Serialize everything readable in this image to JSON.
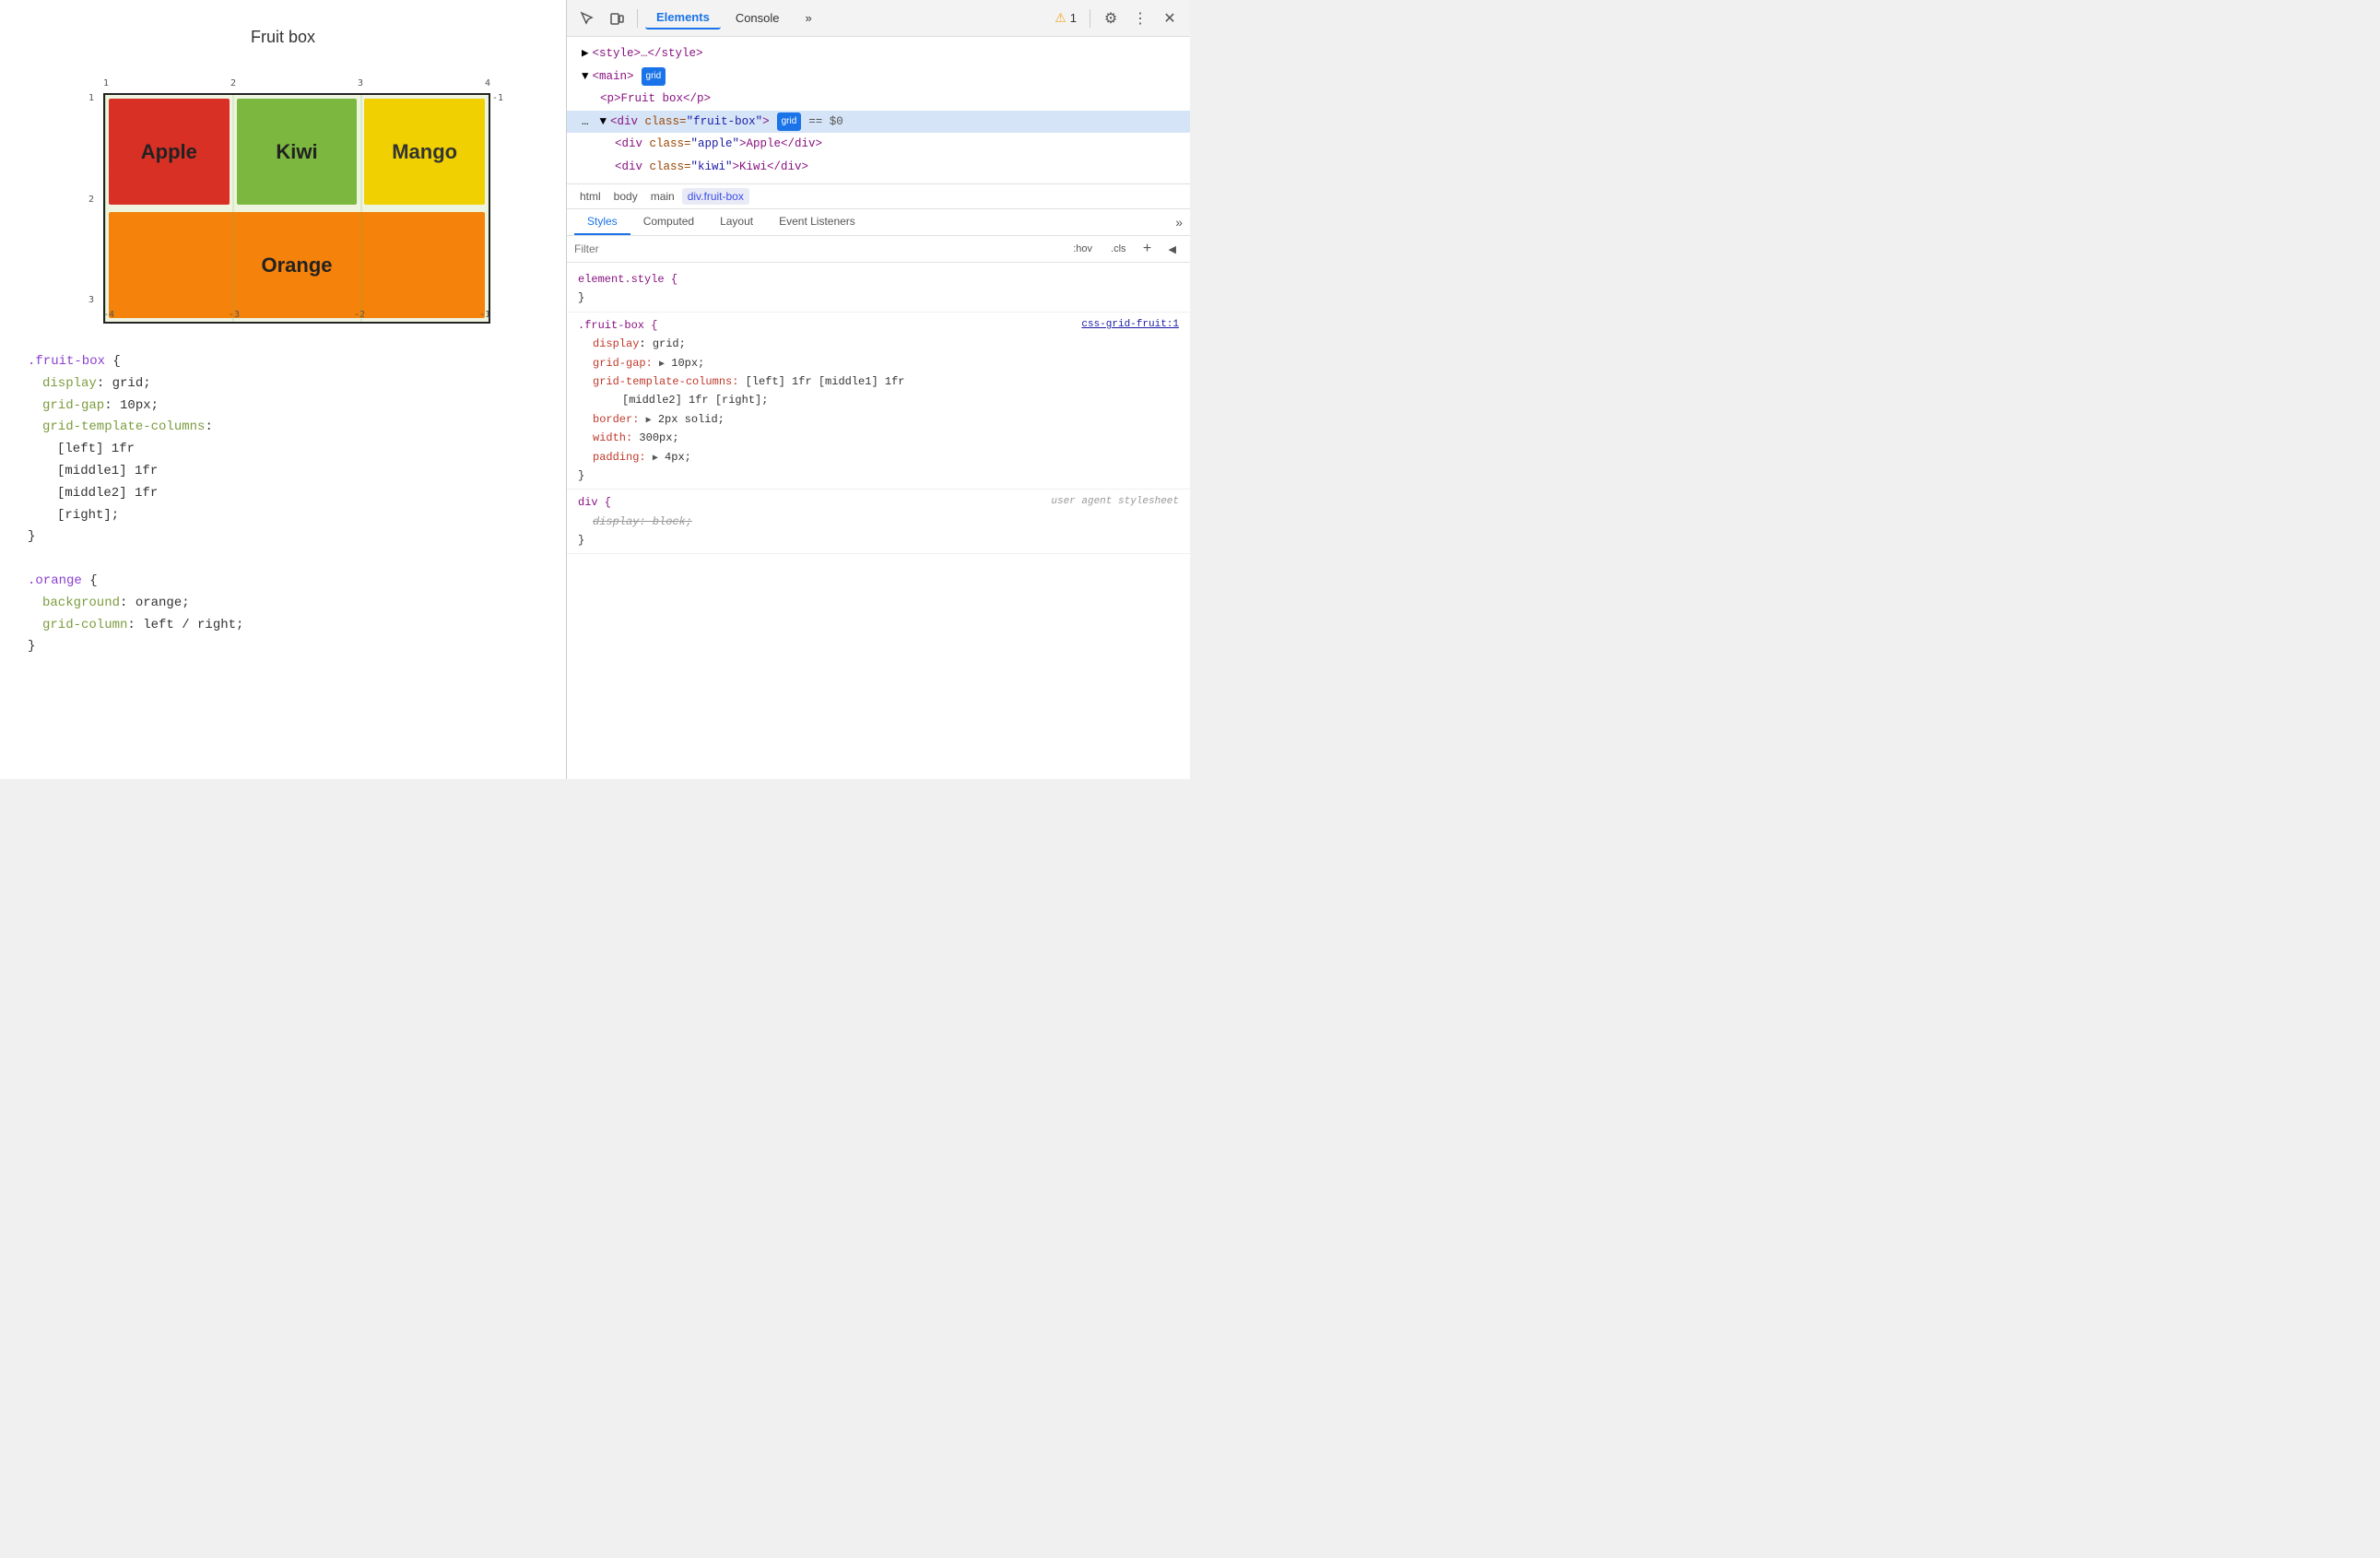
{
  "left_panel": {
    "title": "Fruit box",
    "grid": {
      "top_numbers": [
        "1",
        "2",
        "3",
        "4"
      ],
      "left_numbers": [
        "1",
        "2",
        "3"
      ],
      "bottom_numbers": [
        "-4",
        "-3",
        "-2",
        "-1"
      ],
      "right_numbers": [
        "-1"
      ],
      "cells": [
        {
          "label": "Apple",
          "class": "cell-apple"
        },
        {
          "label": "Kiwi",
          "class": "cell-kiwi"
        },
        {
          "label": "Mango",
          "class": "cell-mango"
        },
        {
          "label": "Orange",
          "class": "cell-orange"
        }
      ]
    },
    "code": [
      {
        "selector": ".fruit-box",
        "properties": [
          {
            "prop": "display",
            "val": "grid"
          },
          {
            "prop": "grid-gap",
            "val": "10px"
          },
          {
            "prop": "grid-template-columns",
            "val": ":"
          },
          {
            "prop": "",
            "val": "[left] 1fr"
          },
          {
            "prop": "",
            "val": "[middle1] 1fr"
          },
          {
            "prop": "",
            "val": "[middle2] 1fr"
          },
          {
            "prop": "",
            "val": "[right];"
          }
        ]
      },
      {
        "selector": ".orange",
        "properties": [
          {
            "prop": "background",
            "val": "orange"
          },
          {
            "prop": "grid-column",
            "val": "left / right"
          }
        ]
      }
    ]
  },
  "right_panel": {
    "toolbar": {
      "tabs": [
        "Elements",
        "Console"
      ],
      "more_label": "»",
      "warning_count": "1",
      "settings_label": "⚙",
      "more_options_label": "⋮",
      "close_label": "✕"
    },
    "dom_tree": {
      "lines": [
        {
          "indent": 0,
          "content": "▶ <style>…</style>",
          "selected": false
        },
        {
          "indent": 0,
          "content": "▼ <main>",
          "badge": "grid",
          "selected": false
        },
        {
          "indent": 1,
          "content": "<p>Fruit box</p>",
          "selected": false
        },
        {
          "indent": 1,
          "content": "▼ <div class=\"fruit-box\">",
          "badge": "grid",
          "dollar_zero": "== $0",
          "selected": true
        },
        {
          "indent": 2,
          "content": "<div class=\"apple\">Apple</div>",
          "selected": false
        },
        {
          "indent": 2,
          "content": "<div class=\"kiwi\">Kiwi</div>",
          "selected": false
        }
      ]
    },
    "breadcrumb": {
      "items": [
        "html",
        "body",
        "main",
        "div.fruit-box"
      ]
    },
    "styles_tabs": {
      "tabs": [
        "Styles",
        "Computed",
        "Layout",
        "Event Listeners"
      ],
      "active": "Styles",
      "more_label": "»"
    },
    "filter": {
      "placeholder": "Filter",
      "hov_label": ":hov",
      "cls_label": ".cls",
      "plus_label": "+",
      "arrow_label": "◀"
    },
    "css_rules": [
      {
        "selector": "element.style {",
        "source": "",
        "properties": [],
        "close": "}"
      },
      {
        "selector": ".fruit-box {",
        "source": "css-grid-fruit:1",
        "properties": [
          {
            "prop": "display",
            "val": "grid;",
            "strikethrough": false
          },
          {
            "prop": "grid-gap:",
            "val": "▶ 10px;",
            "strikethrough": false
          },
          {
            "prop": "grid-template-columns:",
            "val": "[left] 1fr [middle1] 1fr",
            "strikethrough": false
          },
          {
            "prop": "",
            "val": "[middle2] 1fr [right];",
            "strikethrough": false
          },
          {
            "prop": "border:",
            "val": "▶ 2px solid;",
            "strikethrough": false
          },
          {
            "prop": "width:",
            "val": "300px;",
            "strikethrough": false
          },
          {
            "prop": "padding:",
            "val": "▶ 4px;",
            "strikethrough": false
          }
        ],
        "close": "}"
      },
      {
        "selector": "div {",
        "source": "user agent stylesheet",
        "properties": [
          {
            "prop": "display:",
            "val": "block;",
            "strikethrough": true
          }
        ],
        "close": "}"
      }
    ]
  }
}
